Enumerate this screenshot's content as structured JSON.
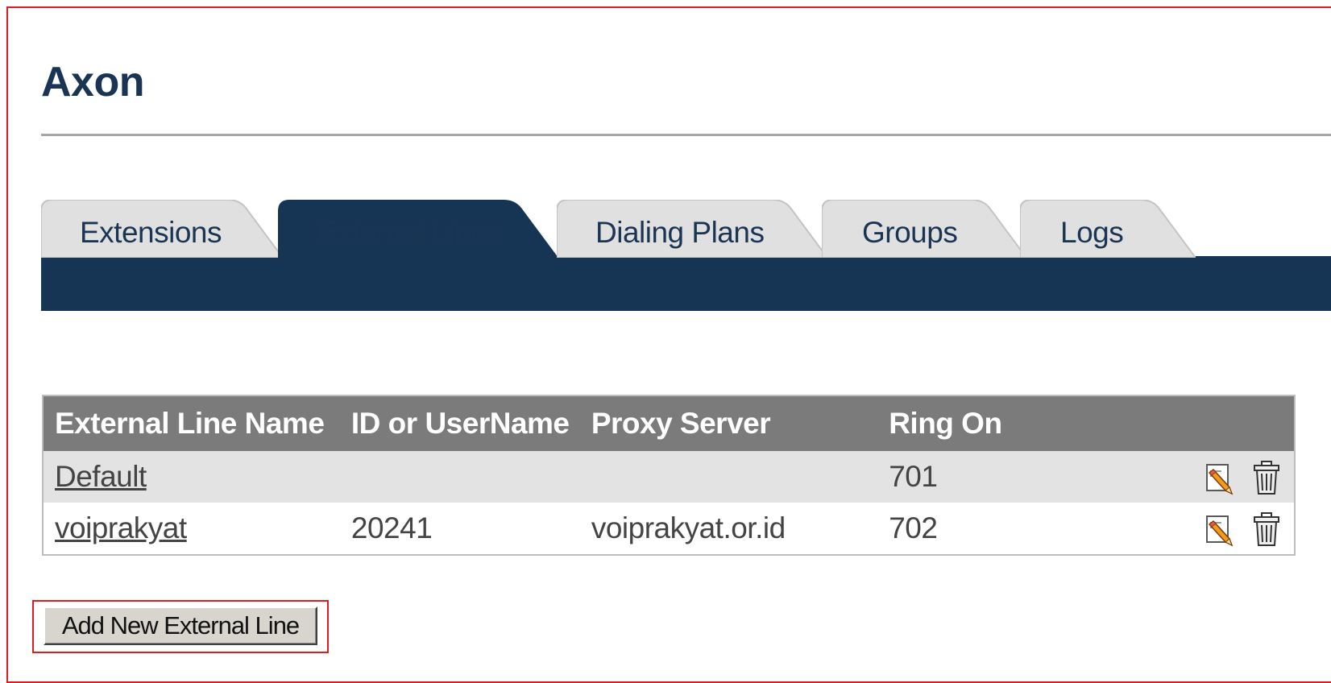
{
  "app": {
    "title": "Axon"
  },
  "tabs": [
    {
      "label": "Extensions",
      "active": false
    },
    {
      "label": "External Lines",
      "active": true
    },
    {
      "label": "Dialing Plans",
      "active": false
    },
    {
      "label": "Groups",
      "active": false
    },
    {
      "label": "Logs",
      "active": false
    }
  ],
  "table": {
    "columns": [
      "External Line Name",
      "ID or UserName",
      "Proxy Server",
      "Ring On"
    ],
    "rows": [
      {
        "name": "Default",
        "id": "",
        "proxy": "",
        "ring_on": "701"
      },
      {
        "name": "voiprakyat",
        "id": "20241",
        "proxy": "voiprakyat.or.id",
        "ring_on": "702"
      }
    ],
    "row_actions": [
      "edit-icon",
      "trash-icon"
    ]
  },
  "actions": {
    "add_label": "Add New External Line"
  },
  "colors": {
    "brand_navy": "#163555",
    "tab_inactive": "#e0e0e0",
    "header_gray": "#7b7b7b",
    "row_alt": "#e3e3e3",
    "highlight_red": "#e11b22"
  }
}
